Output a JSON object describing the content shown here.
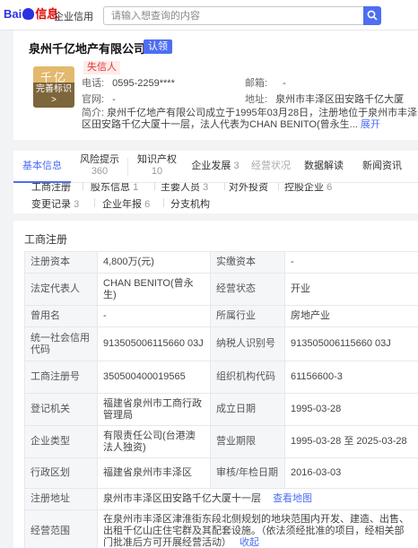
{
  "header": {
    "logo_main_1": "Bai",
    "logo_main_2": "du",
    "logo_sub": "信息",
    "product": "企业信用",
    "search_placeholder": "请输入想查询的内容"
  },
  "company": {
    "name": "泉州千亿地产有限公司",
    "claim_label": "认领",
    "avatar_text": "千亿",
    "avatar_action": "完善标识 >",
    "badge": "失信人",
    "phone_label": "电话:",
    "phone": "0595-2259****",
    "email_label": "邮箱:",
    "email": "-",
    "website_label": "官网:",
    "website": "-",
    "address_label": "地址:",
    "address": "泉州市丰泽区田安路千亿大厦",
    "intro_label": "简介:",
    "intro": "泉州千亿地产有限公司成立于1995年03月28日，注册地位于泉州市丰泽区田安路千亿大厦十一层，法人代表为CHAN BENITO(曾永生...",
    "intro_more": "展开"
  },
  "tabs": [
    {
      "label": "基本信息",
      "count": ""
    },
    {
      "label": "风险提示",
      "count": "360"
    },
    {
      "label": "知识产权",
      "count": "10"
    },
    {
      "label": "企业发展",
      "count": "3"
    },
    {
      "label": "经营状况",
      "count": ""
    },
    {
      "label": "数据解读",
      "count": ""
    },
    {
      "label": "新闻资讯",
      "count": ""
    }
  ],
  "subtabs": [
    {
      "label": "工商注册",
      "count": ""
    },
    {
      "label": "股东信息",
      "count": "1"
    },
    {
      "label": "主要人员",
      "count": "3"
    },
    {
      "label": "对外投资",
      "count": ""
    },
    {
      "label": "控股企业",
      "count": "6"
    },
    {
      "label": "变更记录",
      "count": "3"
    },
    {
      "label": "企业年报",
      "count": "6"
    },
    {
      "label": "分支机构",
      "count": ""
    }
  ],
  "registration": {
    "title": "工商注册",
    "rows": [
      {
        "l1": "注册资本",
        "v1": "4,800万(元)",
        "l2": "实缴资本",
        "v2": "-"
      },
      {
        "l1": "法定代表人",
        "v1": "CHAN BENITO(曾永生)",
        "l2": "经营状态",
        "v2": "开业"
      },
      {
        "l1": "曾用名",
        "v1": "-",
        "l2": "所属行业",
        "v2": "房地产业"
      },
      {
        "l1": "统一社会信用代码",
        "v1": "913505006115660 03J",
        "l2": "纳税人识别号",
        "v2": "913505006115660 03J"
      },
      {
        "l1": "工商注册号",
        "v1": "350500400019565",
        "l2": "组织机构代码",
        "v2": "61156600-3"
      },
      {
        "l1": "登记机关",
        "v1": "福建省泉州市工商行政管理局",
        "l2": "成立日期",
        "v2": "1995-03-28"
      },
      {
        "l1": "企业类型",
        "v1": "有限责任公司(台港澳法人独资)",
        "l2": "营业期限",
        "v2": "1995-03-28 至 2025-03-28"
      },
      {
        "l1": "行政区划",
        "v1": "福建省泉州市丰泽区",
        "l2": "审核/年检日期",
        "v2": "2016-03-03"
      }
    ],
    "reg_address_label": "注册地址",
    "reg_address": "泉州市丰泽区田安路千亿大厦十一层",
    "map_link": "查看地图",
    "scope_label": "经营范围",
    "scope": "在泉州市丰泽区津淮街东段北侧规划的地块范围内开发、建造、出售、出租千亿山庄住宅群及其配套设施。（依法须经批准的项目，经相关部门批准后方可开展经营活动）",
    "scope_more": "收起"
  }
}
